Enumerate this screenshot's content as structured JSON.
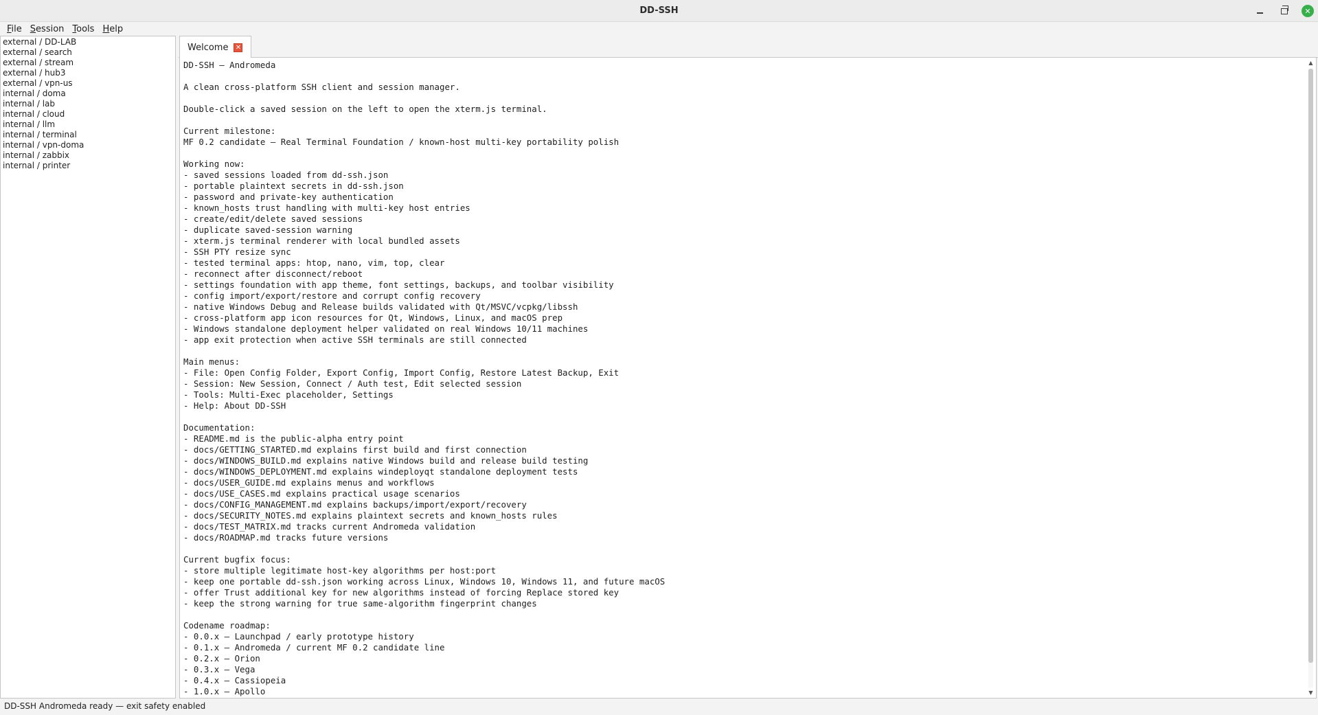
{
  "window": {
    "title": "DD-SSH",
    "minimize_icon": "minimize-icon",
    "maximize_icon": "maximize-icon",
    "close_glyph": "✕"
  },
  "menu": [
    {
      "accel": "F",
      "rest": "ile"
    },
    {
      "accel": "S",
      "rest": "ession"
    },
    {
      "accel": "T",
      "rest": "ools"
    },
    {
      "accel": "H",
      "rest": "elp"
    }
  ],
  "sessions": [
    "external / DD-LAB",
    "external / search",
    "external / stream",
    "external / hub3",
    "external / vpn-us",
    "internal / doma",
    "internal / lab",
    "internal / cloud",
    "internal / llm",
    "internal / terminal",
    "internal / vpn-doma",
    "internal / zabbix",
    "internal / printer"
  ],
  "tab": {
    "label": "Welcome",
    "close_glyph": "✕"
  },
  "welcome_lines": [
    "DD-SSH — Andromeda",
    "",
    "A clean cross-platform SSH client and session manager.",
    "",
    "Double-click a saved session on the left to open the xterm.js terminal.",
    "",
    "Current milestone:",
    "MF 0.2 candidate — Real Terminal Foundation / known-host multi-key portability polish",
    "",
    "Working now:",
    "- saved sessions loaded from dd-ssh.json",
    "- portable plaintext secrets in dd-ssh.json",
    "- password and private-key authentication",
    "- known_hosts trust handling with multi-key host entries",
    "- create/edit/delete saved sessions",
    "- duplicate saved-session warning",
    "- xterm.js terminal renderer with local bundled assets",
    "- SSH PTY resize sync",
    "- tested terminal apps: htop, nano, vim, top, clear",
    "- reconnect after disconnect/reboot",
    "- settings foundation with app theme, font settings, backups, and toolbar visibility",
    "- config import/export/restore and corrupt config recovery",
    "- native Windows Debug and Release builds validated with Qt/MSVC/vcpkg/libssh",
    "- cross-platform app icon resources for Qt, Windows, Linux, and macOS prep",
    "- Windows standalone deployment helper validated on real Windows 10/11 machines",
    "- app exit protection when active SSH terminals are still connected",
    "",
    "Main menus:",
    "- File: Open Config Folder, Export Config, Import Config, Restore Latest Backup, Exit",
    "- Session: New Session, Connect / Auth test, Edit selected session",
    "- Tools: Multi-Exec placeholder, Settings",
    "- Help: About DD-SSH",
    "",
    "Documentation:",
    "- README.md is the public-alpha entry point",
    "- docs/GETTING_STARTED.md explains first build and first connection",
    "- docs/WINDOWS_BUILD.md explains native Windows build and release build testing",
    "- docs/WINDOWS_DEPLOYMENT.md explains windeployqt standalone deployment tests",
    "- docs/USER_GUIDE.md explains menus and workflows",
    "- docs/USE_CASES.md explains practical usage scenarios",
    "- docs/CONFIG_MANAGEMENT.md explains backups/import/export/recovery",
    "- docs/SECURITY_NOTES.md explains plaintext secrets and known_hosts rules",
    "- docs/TEST_MATRIX.md tracks current Andromeda validation",
    "- docs/ROADMAP.md tracks future versions",
    "",
    "Current bugfix focus:",
    "- store multiple legitimate host-key algorithms per host:port",
    "- keep one portable dd-ssh.json working across Linux, Windows 10, Windows 11, and future macOS",
    "- offer Trust additional key for new algorithms instead of forcing Replace stored key",
    "- keep the strong warning for true same-algorithm fingerprint changes",
    "",
    "Codename roadmap:",
    "- 0.0.x — Launchpad / early prototype history",
    "- 0.1.x — Andromeda / current MF 0.2 candidate line",
    "- 0.2.x — Orion",
    "- 0.3.x — Vega",
    "- 0.4.x — Cassiopeia",
    "- 1.0.x — Apollo"
  ],
  "scroll": {
    "position_fraction": 0.0,
    "visible_fraction": 0.96,
    "up_glyph": "▲",
    "down_glyph": "▼"
  },
  "status": {
    "text": "DD-SSH Andromeda ready — exit safety enabled"
  },
  "colors": {
    "close_button": "#35b04a",
    "tab_close": "#e8543a"
  }
}
